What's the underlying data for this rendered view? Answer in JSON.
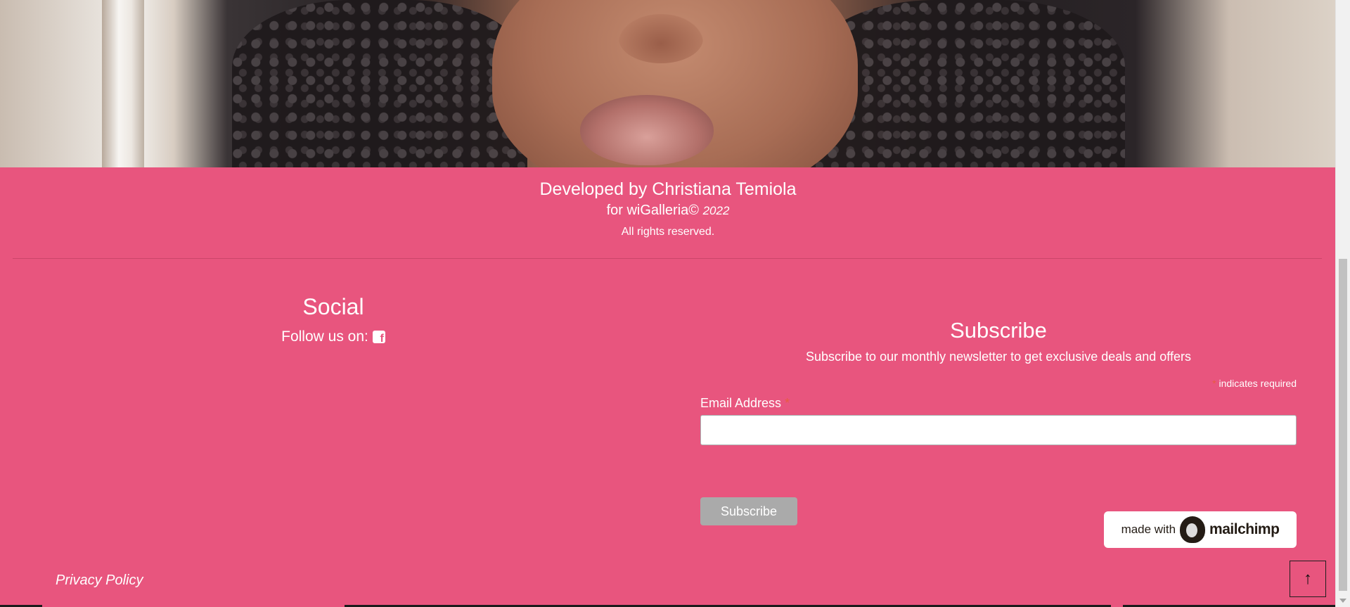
{
  "credits": {
    "developed_by": "Developed by Christiana Temiola",
    "for_brand": "for wiGalleria©",
    "year": "2022",
    "rights": "All rights reserved."
  },
  "social": {
    "title": "Social",
    "follow_label": "Follow us on:",
    "icon": "facebook-square-icon"
  },
  "subscribe": {
    "title": "Subscribe",
    "description": "Subscribe to our monthly newsletter to get exclusive deals and offers",
    "required_marker": "*",
    "required_note": "indicates required",
    "email_label": "Email Address",
    "email_value": "",
    "button_label": "Subscribe"
  },
  "mailchimp_badge": {
    "made_with": "made with",
    "brand": "mailchimp"
  },
  "footer": {
    "privacy_policy": "Privacy Policy",
    "back_to_top_icon": "arrow-up-icon",
    "back_to_top_glyph": "↑"
  },
  "colors": {
    "footer_bg": "#e8557e",
    "button_disabled": "#aaaaaa",
    "required_asterisk": "#e85c41"
  }
}
